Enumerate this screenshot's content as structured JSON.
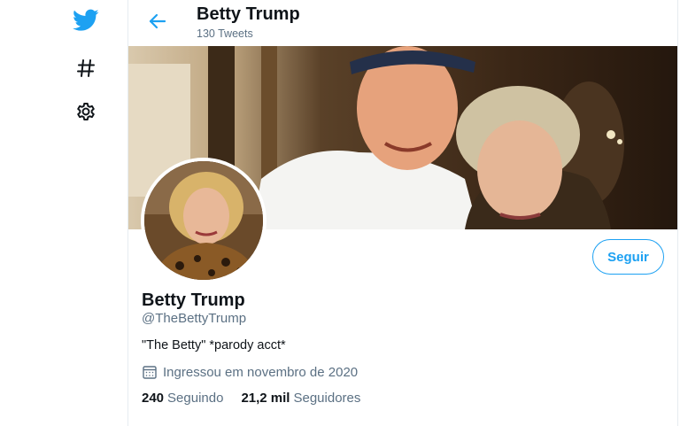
{
  "nav": {
    "icons": [
      "twitter-bird-icon",
      "hashtag-icon",
      "gear-icon"
    ]
  },
  "header": {
    "title": "Betty Trump",
    "tweet_count": "130 Tweets"
  },
  "profile": {
    "name": "Betty Trump",
    "handle": "@TheBettyTrump",
    "bio": "\"The Betty\" *parody acct*",
    "joined": "Ingressou em novembro de 2020",
    "following_count": "240",
    "following_label": "Seguindo",
    "followers_count": "21,2 mil",
    "followers_label": "Seguidores",
    "follow_button": "Seguir"
  },
  "colors": {
    "accent": "#1da1f2",
    "text": "#0f1419",
    "secondary": "#5b7083"
  }
}
